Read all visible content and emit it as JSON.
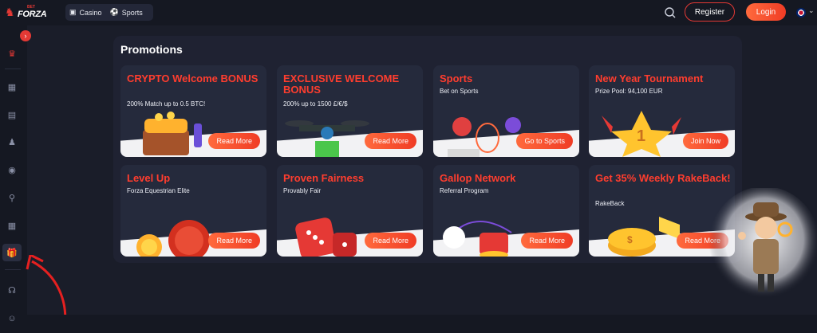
{
  "brand": {
    "logo_small": "BET",
    "logo_main": "FORZA"
  },
  "nav": {
    "casino": "Casino",
    "sports": "Sports"
  },
  "header": {
    "register": "Register",
    "login": "Login"
  },
  "promotions_title": "Promotions",
  "cards": [
    {
      "title": "CRYPTO Welcome BONUS",
      "subtitle": "200% Match up to 0.5 BTC!",
      "button": "Read More"
    },
    {
      "title": "EXCLUSIVE WELCOME BONUS",
      "subtitle": "200% up to 1500 £/€/$",
      "button": "Read More"
    },
    {
      "title": "Sports",
      "subtitle": "Bet on Sports",
      "button": "Go to Sports"
    },
    {
      "title": "New Year Tournament",
      "subtitle": "Prize Pool: 94,100 EUR",
      "button": "Join Now"
    },
    {
      "title": "Level Up",
      "subtitle": "Forza Equestrian Elite",
      "button": "Read More"
    },
    {
      "title": "Proven Fairness",
      "subtitle": "Provably Fair",
      "button": "Read More"
    },
    {
      "title": "Gallop Network",
      "subtitle": "Referral Program",
      "button": "Read More"
    },
    {
      "title": "Get 35% Weekly RakeBack!",
      "subtitle": "RakeBack",
      "button": "Read More"
    }
  ],
  "colors": {
    "accent": "#e53935",
    "bg": "#1a1d29",
    "card": "#252a3c"
  },
  "icons": [
    "search-icon",
    "flag-uk-icon",
    "chevron-down-icon",
    "chevron-right-icon",
    "grid-icon",
    "book-icon",
    "chess-icon",
    "robot-icon",
    "tree-icon",
    "apps-icon",
    "gift-icon",
    "headset-icon",
    "avatar"
  ]
}
